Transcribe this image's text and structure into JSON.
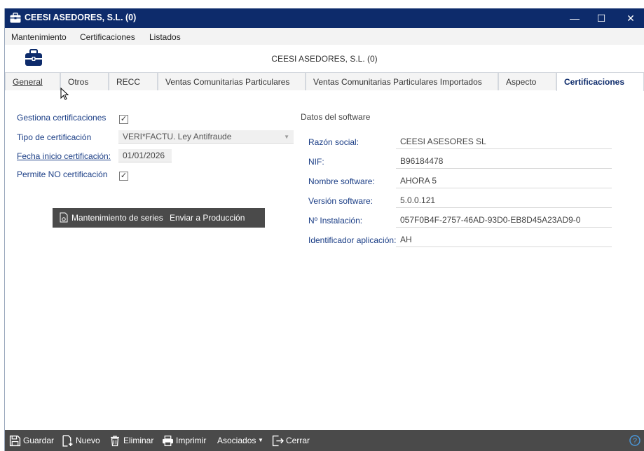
{
  "window": {
    "title": "CEESI ASEDORES, S.L. (0)",
    "controls": {
      "minimize": "—",
      "maximize": "☐",
      "close": "✕"
    }
  },
  "menu": [
    "Mantenimiento",
    "Certificaciones",
    "Listados"
  ],
  "header": {
    "title": "CEESI ASEDORES, S.L. (0)",
    "icon": "briefcase-icon"
  },
  "tabs": [
    {
      "label": "General",
      "active": false
    },
    {
      "label": "Otros",
      "active": false
    },
    {
      "label": "RECC",
      "active": false
    },
    {
      "label": "Ventas Comunitarias Particulares",
      "active": false
    },
    {
      "label": "Ventas Comunitarias Particulares Importados",
      "active": false
    },
    {
      "label": "Aspecto",
      "active": false
    },
    {
      "label": "Certificaciones",
      "active": true
    }
  ],
  "form": {
    "gestiona": {
      "label": "Gestiona certificaciones",
      "checked": true
    },
    "tipo": {
      "label": "Tipo de certificación",
      "value": "VERI*FACTU. Ley Antifraude"
    },
    "fecha": {
      "label": "Fecha inicio certificación:",
      "value": "01/01/2026"
    },
    "permite": {
      "label": "Permite NO certificación",
      "checked": true
    },
    "check_mark": "✓"
  },
  "actions": {
    "mantenimiento": "Mantenimiento de series",
    "enviar": "Enviar a Producción"
  },
  "software": {
    "title": "Datos del software",
    "fields": [
      {
        "label": "Razón social:",
        "value": "CEESI ASESORES SL"
      },
      {
        "label": "NIF:",
        "value": "B96184478"
      },
      {
        "label": "Nombre software:",
        "value": "AHORA 5"
      },
      {
        "label": "Versión software:",
        "value": "5.0.0.121"
      },
      {
        "label": "Nº Instalación:",
        "value": "057F0B4F-2757-46AD-93D0-EB8D45A23AD9-0"
      },
      {
        "label": "Identificador aplicación:",
        "value": "AH"
      }
    ]
  },
  "footer": {
    "guardar": "Guardar",
    "nuevo": "Nuevo",
    "eliminar": "Eliminar",
    "imprimir": "Imprimir",
    "asociados": "Asociados",
    "cerrar": "Cerrar",
    "help": "?"
  },
  "colors": {
    "titlebar": "#0d2b6b",
    "label": "#1b3e86",
    "toolbar": "#4a4a4a"
  }
}
